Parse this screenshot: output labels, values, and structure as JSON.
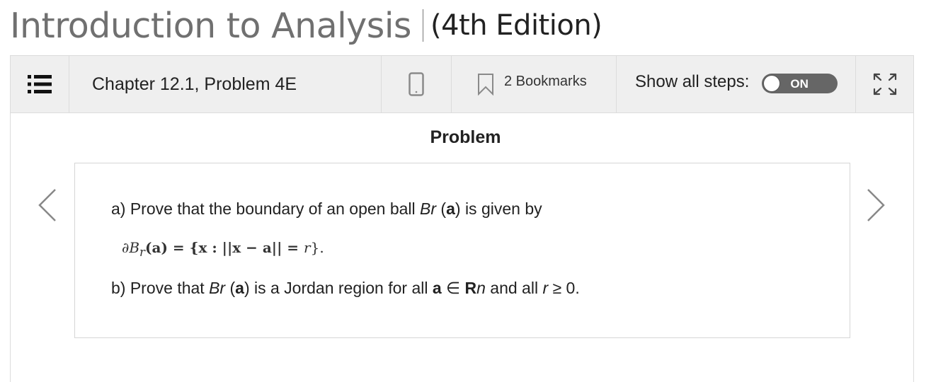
{
  "book": {
    "title": "Introduction to Analysis",
    "edition": "(4th Edition)"
  },
  "toolbar": {
    "menu_icon": "list-icon",
    "chapter": "Chapter 12.1, Problem 4E",
    "mobile_icon": "mobile-phone-icon",
    "bookmark_icon": "bookmark-icon",
    "bookmarks_label": "2 Bookmarks",
    "show_steps_label": "Show all steps:",
    "toggle_label": "ON",
    "toggle_state": true,
    "expand_icon": "expand-icon"
  },
  "problem": {
    "heading": "Problem",
    "part_a": {
      "prefix": "a) Prove that the boundary of an open ball ",
      "B": "Br",
      "open": " (",
      "a": "a",
      "close": ") is given by"
    },
    "formula": {
      "lhs": "∂B",
      "sub": "r",
      "lhs_rest": "(a) = {x : ||x − a|| = ",
      "r": "r",
      "end": "}."
    },
    "part_b": {
      "prefix": "b) Prove that ",
      "B": "Br",
      "open": " (",
      "a": "a",
      "mid": ") is a Jordan region for all ",
      "a2": "a",
      "in": " ∈ ",
      "R": "R",
      "n": "n",
      "and": " and all ",
      "r": "r",
      "end": " ≥ 0."
    }
  },
  "nav": {
    "prev_icon": "chevron-left-icon",
    "next_icon": "chevron-right-icon"
  }
}
